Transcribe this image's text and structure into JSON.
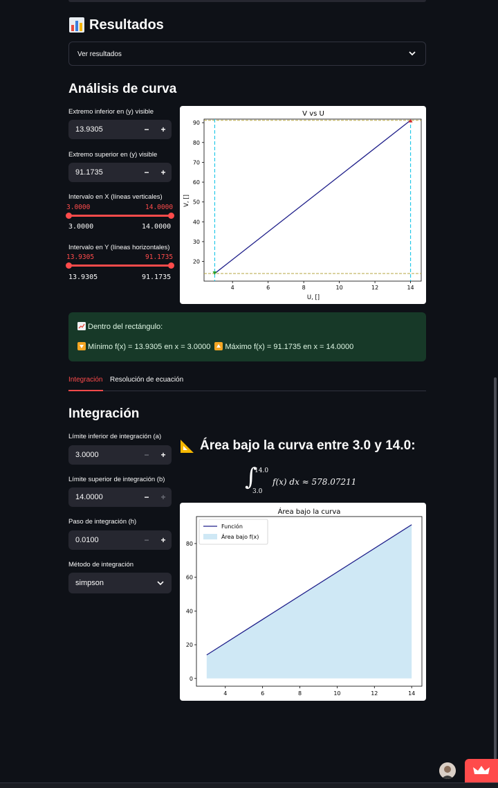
{
  "header": {
    "title": "Resultados",
    "icon": "bar-chart-icon"
  },
  "expander": {
    "label": "Ver resultados"
  },
  "analysis": {
    "title": "Análisis de curva",
    "y_lower": {
      "label": "Extremo inferior en (y) visible",
      "value": "13.9305"
    },
    "y_upper": {
      "label": "Extremo superior en (y) visible",
      "value": "91.1735"
    },
    "x_interval": {
      "label": "Intervalo en X (líneas verticales)",
      "low": "3.0000",
      "high": "14.0000"
    },
    "y_interval": {
      "label": "Intervalo en Y (líneas horizontales)",
      "low": "13.9305",
      "high": "91.1735"
    },
    "step_buttons": {
      "minus": "−",
      "plus": "+"
    }
  },
  "result_box": {
    "title": "Dentro del rectángulo:",
    "line": "Mínimo f(x) = 13.9305 en x = 3.0000",
    "line2": "Máximo f(x) = 91.1735 en x = 14.0000",
    "success_color": "#173928"
  },
  "tabs": [
    {
      "label": "Integración",
      "active": true
    },
    {
      "label": "Resolución de ecuación",
      "active": false
    }
  ],
  "integration": {
    "title": "Integración",
    "a": {
      "label": "Límite inferior de integración (a)",
      "value": "3.0000"
    },
    "b": {
      "label": "Límite superior de integración (b)",
      "value": "14.0000"
    },
    "h": {
      "label": "Paso de integración (h)",
      "value": "0.0100"
    },
    "method": {
      "label": "Método de integración",
      "value": "simpson"
    },
    "area_title": "Área bajo la curva entre 3.0 y 14.0:",
    "formula": {
      "upper": "14.0",
      "lower": "3.0",
      "body": "f(x) dx ≈ 578.07211"
    }
  },
  "chart_data": [
    {
      "type": "line",
      "title": "V vs U",
      "xlabel": "U, []",
      "ylabel": "V, []",
      "x": [
        3.0,
        14.0
      ],
      "y": [
        13.9305,
        91.1735
      ],
      "xlim": [
        2.4,
        14.6
      ],
      "ylim": [
        10.07,
        91.8
      ],
      "xticks": [
        4,
        6,
        8,
        10,
        12,
        14
      ],
      "yticks": [
        20,
        30,
        40,
        50,
        60,
        70,
        80,
        90
      ],
      "vlines": [
        3.0,
        14.0
      ],
      "hlines": [
        13.9305,
        91.1735
      ],
      "min_point": [
        3.0,
        13.9305
      ],
      "max_point": [
        14.0,
        91.1735
      ],
      "colors": {
        "line": "#1f1f8a",
        "vline": "#22c8e8",
        "hline": "#b5a642",
        "min": "#2ca02c",
        "max": "#d62728"
      }
    },
    {
      "type": "area",
      "title": "Área bajo la curva",
      "x": [
        3.0,
        14.0
      ],
      "y": [
        13.9305,
        91.1735
      ],
      "xlim": [
        2.45,
        14.55
      ],
      "ylim": [
        -4.6,
        96
      ],
      "xticks": [
        4,
        6,
        8,
        10,
        12,
        14
      ],
      "yticks": [
        0,
        20,
        40,
        60,
        80
      ],
      "legend": [
        "Función",
        "Área bajo f(x)"
      ],
      "legend_position": "top-left",
      "colors": {
        "line": "#1f1f8a",
        "fill": "#cfe8f5"
      }
    }
  ]
}
